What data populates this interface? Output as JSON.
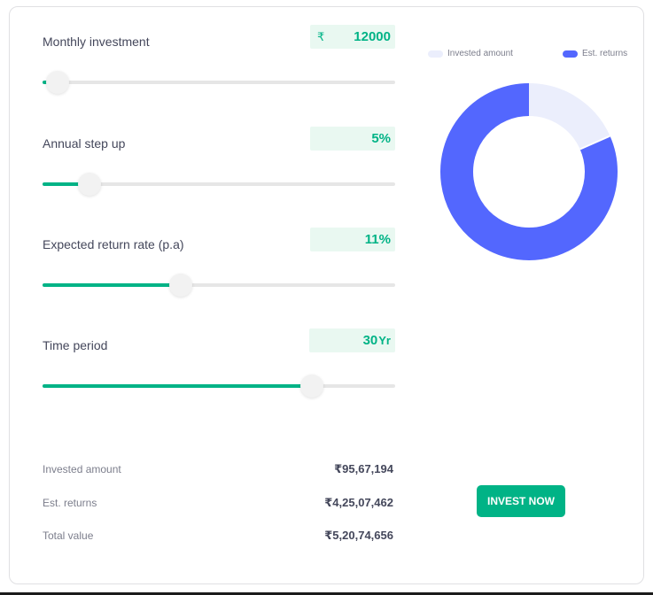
{
  "colors": {
    "accent": "#00b386",
    "invested": "#ebeefc",
    "returns": "#5367fe"
  },
  "inputs": [
    {
      "id": "monthly-investment",
      "label": "Monthly investment",
      "prefix": "₹",
      "value": "12000",
      "suffix": "",
      "slider_fraction": 0.01
    },
    {
      "id": "annual-step-up",
      "label": "Annual step up",
      "prefix": "",
      "value": "5%",
      "suffix": "",
      "slider_fraction": 0.1
    },
    {
      "id": "expected-return-rate",
      "label": "Expected return rate (p.a)",
      "prefix": "",
      "value": "11%",
      "suffix": "",
      "slider_fraction": 0.36
    },
    {
      "id": "time-period",
      "label": "Time period",
      "prefix": "",
      "value": "30",
      "suffix": "Yr",
      "slider_fraction": 0.73
    }
  ],
  "chart_data": {
    "type": "pie",
    "labels": [
      "Invested amount",
      "Est. returns"
    ],
    "values": [
      9567194,
      42507462
    ],
    "legend_position": "top"
  },
  "summary": {
    "invested_label": "Invested amount",
    "invested_value": "₹95,67,194",
    "returns_label": "Est. returns",
    "returns_value": "₹4,25,07,462",
    "total_label": "Total value",
    "total_value": "₹5,20,74,656"
  },
  "invest_button": "INVEST NOW"
}
